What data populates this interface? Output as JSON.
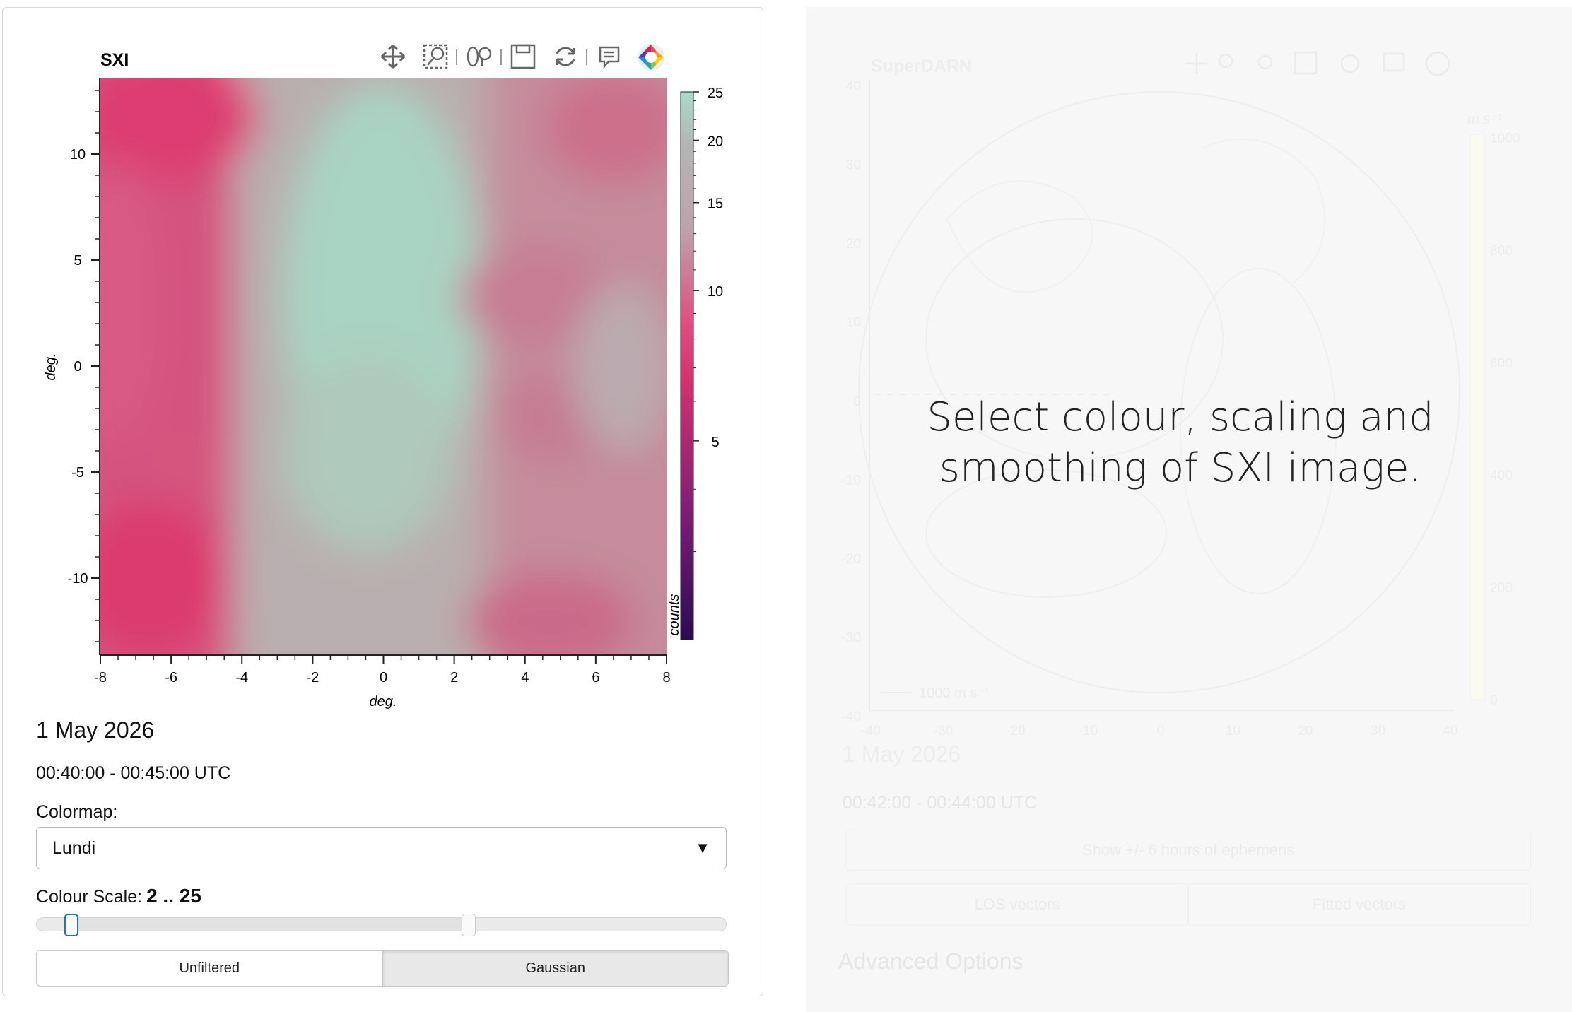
{
  "sxi": {
    "title": "SXI",
    "xlabel": "deg.",
    "ylabel": "deg.",
    "x_ticks": [
      "-8",
      "-6",
      "-4",
      "-2",
      "0",
      "2",
      "4",
      "6",
      "8"
    ],
    "y_ticks": [
      "10",
      "5",
      "0",
      "-5",
      "-10"
    ],
    "colorbar": {
      "label": "counts",
      "ticks": [
        "25",
        "20",
        "15",
        "10",
        "5"
      ],
      "range": [
        2,
        25
      ],
      "scale": "log"
    },
    "toolbar": [
      "pan-icon",
      "box-zoom-icon",
      "wheel-zoom-icon",
      "save-icon",
      "reset-icon",
      "hover-icon",
      "bokeh-logo-icon"
    ]
  },
  "date": "1 May 2026",
  "time_range": "00:40:00 - 00:45:00 UTC",
  "colormap": {
    "label": "Colormap:",
    "value": "Lundi"
  },
  "colour_scale": {
    "label": "Colour Scale:",
    "value": "2 .. 25",
    "low": 2,
    "high": 25,
    "min": 0,
    "max": 40
  },
  "filter": {
    "options": [
      "Unfiltered",
      "Gaussian"
    ],
    "selected": "Gaussian"
  },
  "message": {
    "line1": "Select colour, scaling and",
    "line2": "smoothing of SXI image."
  },
  "superdarn": {
    "title": "SuperDARN",
    "date": "1 May 2026",
    "time_range": "00:42:00 - 00:44:00 UTC",
    "ephemeris_button": "Show +/- 6 hours of ephemeris",
    "vector_options": [
      "LOS vectors",
      "Fitted vectors"
    ],
    "advanced": "Advanced Options",
    "colorbar_unit": "m s⁻¹",
    "colorbar_ticks": [
      "1000",
      "800",
      "600",
      "400",
      "200",
      "0"
    ],
    "x_ticks": [
      "-40",
      "-30",
      "-20",
      "-10",
      "0",
      "10",
      "20",
      "30",
      "40"
    ],
    "y_ticks": [
      "40",
      "30",
      "20",
      "10",
      "0",
      "-10",
      "-20",
      "-30",
      "-40"
    ],
    "scale_vector": "1000 m s⁻¹"
  },
  "colors": {
    "pink": "#d9386f",
    "grey": "#b4a9ac",
    "mint": "#a6d6c3",
    "accent": "#1a73c8"
  }
}
